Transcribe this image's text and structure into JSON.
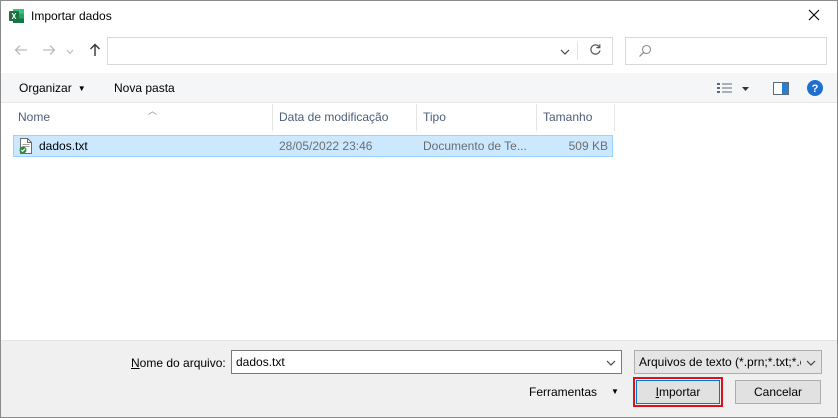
{
  "window": {
    "title": "Importar dados"
  },
  "address": {
    "path": "",
    "search_placeholder": ""
  },
  "commandbar": {
    "organize_label": "Organizar",
    "newfolder_label": "Nova pasta"
  },
  "columns": {
    "name": "Nome",
    "date": "Data de modificação",
    "type": "Tipo",
    "size": "Tamanho"
  },
  "files": [
    {
      "name": "dados.txt",
      "date": "28/05/2022 23:46",
      "type": "Documento de Te...",
      "size": "509 KB"
    }
  ],
  "bottom": {
    "filename_label_prefix": "N",
    "filename_label_rest": "ome do arquivo:",
    "filename_value": "dados.txt",
    "filter_value": "Arquivos de texto (*.prn;*.txt;*.csv)",
    "tools_label": "Ferramentas",
    "import_prefix": "I",
    "import_rest": "mportar",
    "cancel_label": "Cancelar"
  },
  "colors": {
    "selection": "#cce8ff",
    "selection_border": "#99d1ff",
    "accent": "#0078d7",
    "highlight": "#d9141c",
    "excel_green": "#1d6f42"
  },
  "icons": [
    "excel-icon",
    "close-icon",
    "back-arrow-icon",
    "forward-arrow-icon",
    "chevron-down-icon",
    "up-arrow-icon",
    "refresh-icon",
    "search-icon",
    "view-options-icon",
    "preview-pane-icon",
    "help-icon",
    "text-file-icon"
  ]
}
